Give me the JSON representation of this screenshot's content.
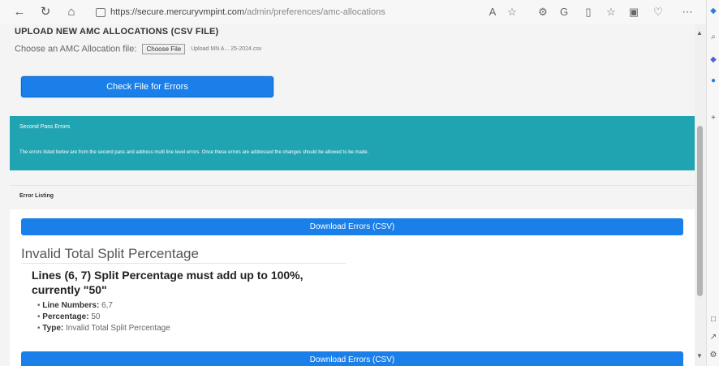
{
  "browser": {
    "url": "https://secure.mercuryvmpint.com/admin/preferences/amc-allocations",
    "url_host": "https://secure.mercuryvmpint.com",
    "url_path": "/admin/preferences/amc-allocations"
  },
  "upload": {
    "title": "UPLOAD NEW AMC ALLOCATIONS (CSV FILE)",
    "choose_label": "Choose an AMC Allocation file:",
    "choose_button": "Choose File",
    "chosen_file": "Upload MN A... 25-2024.csv",
    "check_button": "Check File for Errors"
  },
  "second_pass": {
    "title": "Second Pass Errors",
    "message": "The errors listed below are from the second pass and address multi line level errors. Once these errors are addressed the changes should be allowed to be made."
  },
  "error_listing": {
    "title": "Error Listing",
    "download_button": "Download Errors (CSV)",
    "error": {
      "heading": "Invalid Total Split Percentage",
      "message": "Lines (6, 7) Split Percentage must add up to 100%, currently \"50\"",
      "details": [
        {
          "label": "Line Numbers:",
          "value": "6,7"
        },
        {
          "label": "Percentage:",
          "value": "50"
        },
        {
          "label": "Type:",
          "value": "Invalid Total Split Percentage"
        }
      ]
    }
  },
  "colors": {
    "primary_button": "#1a7fe8",
    "teal_banner": "#20a4b1"
  }
}
